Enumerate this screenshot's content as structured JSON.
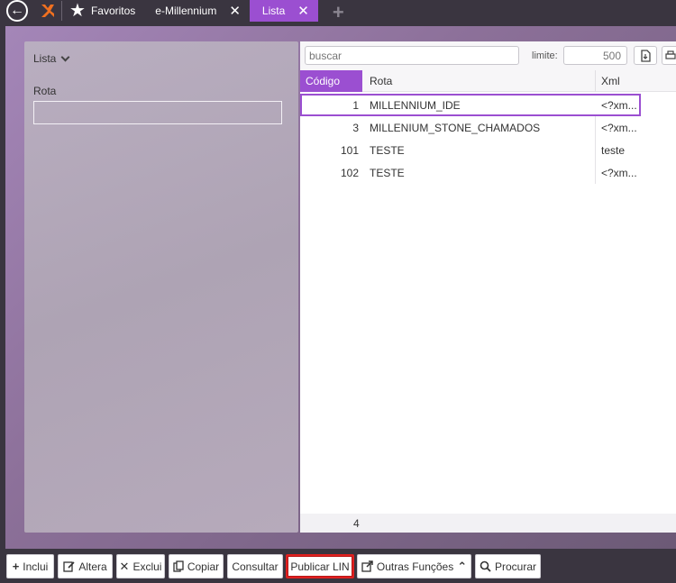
{
  "topbar": {
    "favorites_label": "Favoritos",
    "tabs": [
      {
        "label": "e-Millennium",
        "active": false
      },
      {
        "label": "Lista",
        "active": true
      }
    ]
  },
  "left_panel": {
    "title": "Lista",
    "field_label": "Rota",
    "field_value": ""
  },
  "right_panel": {
    "search_placeholder": "buscar",
    "limit_label": "limite:",
    "limit_value": "500",
    "columns": [
      "Código",
      "Rota",
      "Xml"
    ],
    "rows": [
      {
        "codigo": "1",
        "rota": "MILLENNIUM_IDE",
        "xml": "<?xm...",
        "selected": true
      },
      {
        "codigo": "3",
        "rota": "MILLENIUM_STONE_CHAMADOS",
        "xml": "<?xm...",
        "selected": false
      },
      {
        "codigo": "101",
        "rota": "TESTE",
        "xml": "teste",
        "selected": false
      },
      {
        "codigo": "102",
        "rota": "TESTE",
        "xml": "<?xm...",
        "selected": false
      }
    ],
    "footer_count": "4"
  },
  "toolbar": {
    "buttons": [
      {
        "label": "Inclui",
        "icon": "plus-icon"
      },
      {
        "label": "Altera",
        "icon": "edit-icon"
      },
      {
        "label": "Exclui",
        "icon": "close-icon"
      },
      {
        "label": "Copiar",
        "icon": "copy-icon"
      },
      {
        "label": "Consultar",
        "icon": ""
      },
      {
        "label": "Publicar LIN",
        "icon": ""
      },
      {
        "label": "Outras Funções",
        "icon": "external-link-icon"
      },
      {
        "label": "Procurar",
        "icon": "search-icon"
      }
    ]
  },
  "colors": {
    "accent": "#9b4fd1",
    "highlight": "#e02020",
    "background": "#3a3540"
  }
}
